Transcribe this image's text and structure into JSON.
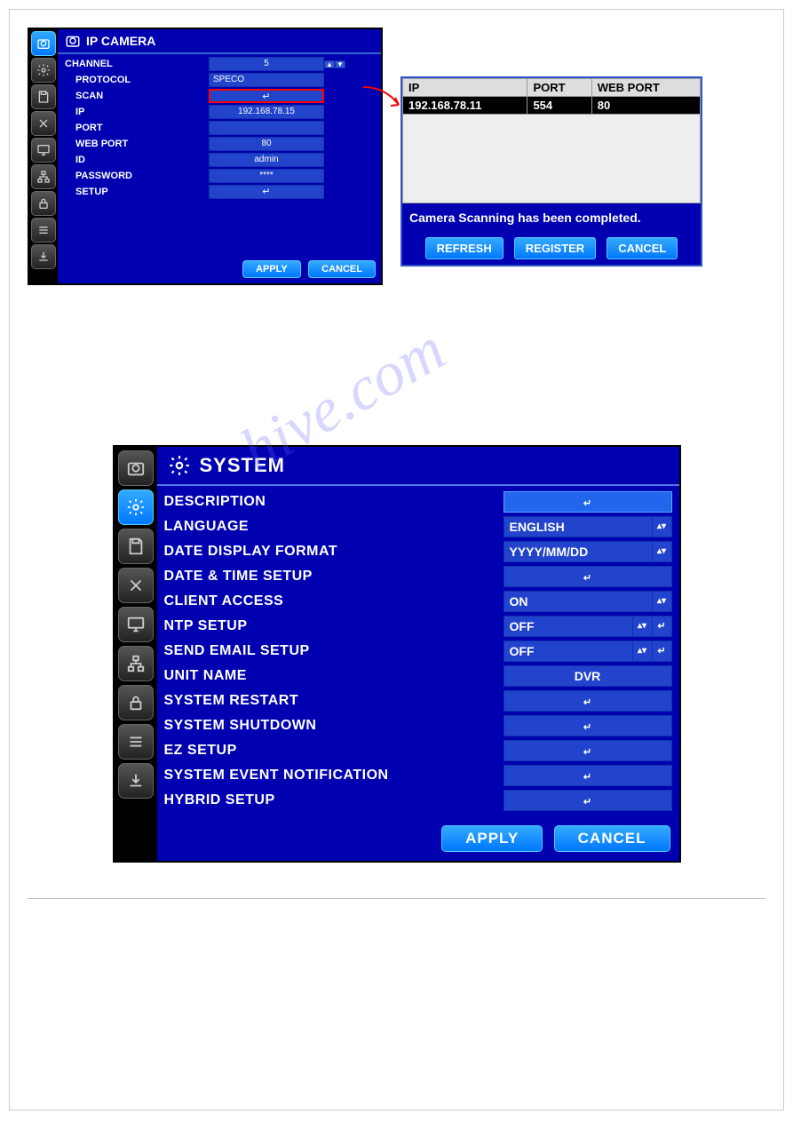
{
  "watermark": "hive.com",
  "panel1": {
    "title": "IP CAMERA",
    "rows": {
      "channel_label": "CHANNEL",
      "channel_val": "5",
      "protocol_label": "PROTOCOL",
      "protocol_val": "SPECO",
      "scan_label": "SCAN",
      "scan_val": "",
      "ip_label": "IP",
      "ip_val": "192.168.78.15",
      "port_label": "PORT",
      "port_val": "",
      "webport_label": "WEB PORT",
      "webport_val": "80",
      "id_label": "ID",
      "id_val": "admin",
      "password_label": "PASSWORD",
      "password_val": "****",
      "setup_label": "SETUP",
      "setup_val": ""
    },
    "apply": "APPLY",
    "cancel": "CANCEL"
  },
  "popup": {
    "headers": {
      "ip": "IP",
      "port": "PORT",
      "webport": "WEB PORT"
    },
    "row": {
      "ip": "192.168.78.11",
      "port": "554",
      "webport": "80"
    },
    "status": "Camera Scanning has been completed.",
    "refresh": "REFRESH",
    "register": "REGISTER",
    "cancel": "CANCEL"
  },
  "panel2": {
    "title": "SYSTEM",
    "rows": {
      "description_label": "DESCRIPTION",
      "description_val": "",
      "language_label": "LANGUAGE",
      "language_val": "ENGLISH",
      "dateformat_label": "DATE DISPLAY FORMAT",
      "dateformat_val": "YYYY/MM/DD",
      "datetime_label": "DATE & TIME SETUP",
      "client_label": "CLIENT ACCESS",
      "client_val": "ON",
      "ntp_label": "NTP SETUP",
      "ntp_val": "OFF",
      "email_label": "SEND EMAIL SETUP",
      "email_val": "OFF",
      "unit_label": "UNIT NAME",
      "unit_val": "DVR",
      "restart_label": "SYSTEM RESTART",
      "shutdown_label": "SYSTEM SHUTDOWN",
      "ez_label": "EZ SETUP",
      "event_label": "SYSTEM EVENT NOTIFICATION",
      "hybrid_label": "HYBRID SETUP"
    },
    "apply": "APPLY",
    "cancel": "CANCEL"
  },
  "icons": {
    "camera": "camera",
    "gear": "gear",
    "save": "save",
    "tools": "tools",
    "monitor": "monitor",
    "network": "network",
    "lock": "lock",
    "list": "list",
    "download": "download"
  }
}
